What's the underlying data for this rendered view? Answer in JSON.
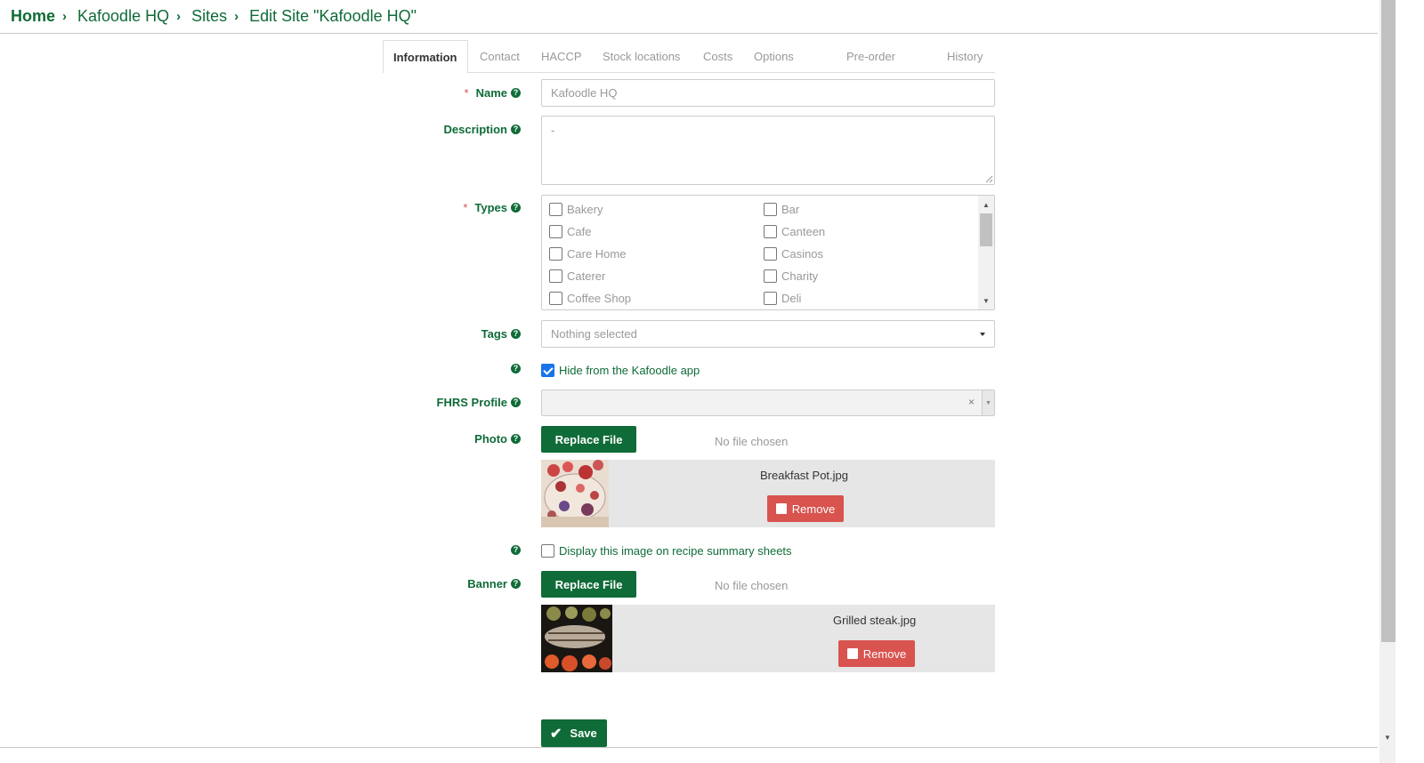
{
  "breadcrumb": [
    "Home",
    "Kafoodle HQ",
    "Sites",
    "Edit Site \"Kafoodle HQ\""
  ],
  "tabs": [
    "Information",
    "Contact",
    "HACCP",
    "Stock locations",
    "Costs",
    "Options",
    "Pre-order",
    "History"
  ],
  "form": {
    "name": {
      "label": "Name",
      "value": "Kafoodle HQ"
    },
    "description": {
      "label": "Description",
      "value": "-"
    },
    "types": {
      "label": "Types",
      "options": [
        {
          "label": "Bakery",
          "checked": false
        },
        {
          "label": "Bar",
          "checked": false
        },
        {
          "label": "Cafe",
          "checked": false
        },
        {
          "label": "Canteen",
          "checked": false
        },
        {
          "label": "Care Home",
          "checked": false
        },
        {
          "label": "Casinos",
          "checked": false
        },
        {
          "label": "Caterer",
          "checked": false
        },
        {
          "label": "Charity",
          "checked": false
        },
        {
          "label": "Coffee Shop",
          "checked": false
        },
        {
          "label": "Deli",
          "checked": false
        }
      ]
    },
    "tags": {
      "label": "Tags",
      "value": "Nothing selected"
    },
    "hide_app": {
      "label": "Hide from the Kafoodle app",
      "checked": true
    },
    "fhrs": {
      "label": "FHRS Profile",
      "value": "",
      "clear": "×"
    },
    "photo": {
      "label": "Photo",
      "button": "Replace File",
      "no_file": "No file chosen",
      "file_name": "Breakfast Pot.jpg",
      "remove": "Remove"
    },
    "display_image": {
      "label": "Display this image on recipe summary sheets",
      "checked": false
    },
    "banner": {
      "label": "Banner",
      "button": "Replace File",
      "no_file": "No file chosen",
      "file_name": "Grilled steak.jpg",
      "remove": "Remove"
    },
    "save": "Save"
  },
  "colors": {
    "brand_green": "#0f6b37",
    "danger_red": "#d9534f",
    "checkbox_blue": "#1a73e8"
  }
}
